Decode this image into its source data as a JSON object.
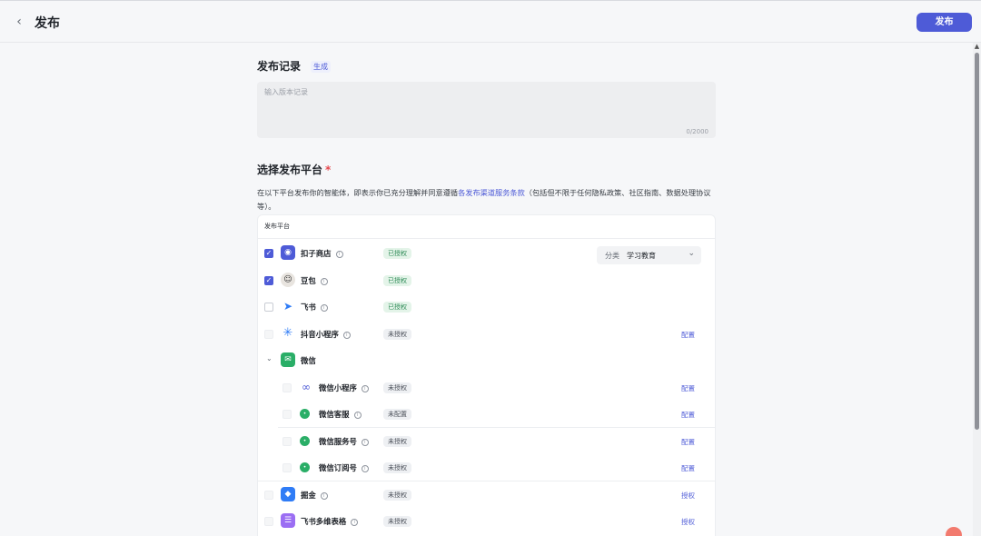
{
  "header": {
    "back_icon": "chevron-left-icon",
    "title": "发布",
    "publish_label": "发布"
  },
  "record": {
    "title": "发布记录",
    "generate_label": "生成",
    "placeholder": "输入版本记录",
    "counter": "0/2000"
  },
  "platform": {
    "title": "选择发布平台",
    "required_mark": "*",
    "desc_prefix": "在以下平台发布你的智能体，即表示你已充分理解并同意遵循",
    "desc_link": "各发布渠道服务条款",
    "desc_suffix": "（包括但不限于任何隐私政策、社区指南、数据处理协议等）。",
    "panel_header": "发布平台",
    "category_label": "分类",
    "category_value": "学习教育",
    "rows": [
      {
        "name": "扣子商店",
        "status": "已授权",
        "checked": true,
        "action": ""
      },
      {
        "name": "豆包",
        "status": "已授权",
        "checked": true,
        "action": ""
      },
      {
        "name": "飞书",
        "status": "已授权",
        "checked": false,
        "action": ""
      },
      {
        "name": "抖音小程序",
        "status": "未授权",
        "checked": false,
        "action": "配置"
      },
      {
        "name": "微信",
        "status": "",
        "checked": false,
        "action": ""
      },
      {
        "name": "微信小程序",
        "status": "未授权",
        "checked": false,
        "action": "配置"
      },
      {
        "name": "微信客服",
        "status": "未配置",
        "checked": false,
        "action": "配置"
      },
      {
        "name": "微信服务号",
        "status": "未授权",
        "checked": false,
        "action": "配置"
      },
      {
        "name": "微信订阅号",
        "status": "未授权",
        "checked": false,
        "action": "配置"
      },
      {
        "name": "掘金",
        "status": "未授权",
        "checked": false,
        "action": "授权"
      },
      {
        "name": "飞书多维表格",
        "status": "未授权",
        "checked": false,
        "action": "授权"
      }
    ]
  },
  "colors": {
    "accent": "#4e5bd7",
    "authorized_bg": "#e4f4e9",
    "authorized_text": "#2e8b57",
    "wechat_green": "#2aae67"
  }
}
